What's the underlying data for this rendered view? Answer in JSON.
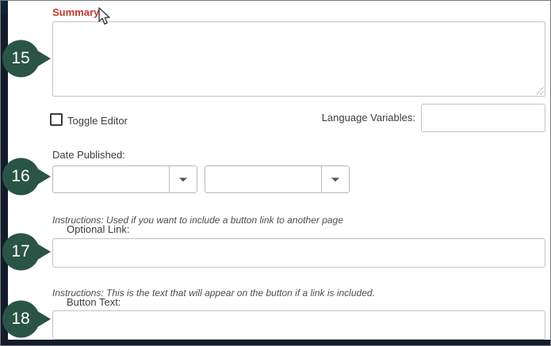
{
  "colors": {
    "callout_green": "#2a5446",
    "frame_dark": "#131c2b",
    "frame_top_teal": "#0e2433",
    "summary_red": "#c13a2c",
    "label_gray": "#3d3d3d",
    "input_border": "#c2c2c2"
  },
  "callouts": [
    {
      "number": "15"
    },
    {
      "number": "16"
    },
    {
      "number": "17"
    },
    {
      "number": "18"
    }
  ],
  "summary": {
    "label": "Summary:",
    "value": ""
  },
  "editor": {
    "toggle_label": "Toggle Editor",
    "checked": false
  },
  "language_variables": {
    "label": "Language Variables:",
    "value": ""
  },
  "date_published": {
    "label": "Date Published:",
    "dropdowns": [
      {
        "value": ""
      },
      {
        "value": ""
      }
    ]
  },
  "optional_link": {
    "instructions": "Instructions: Used if you want to include a button link to another page",
    "label": "Optional Link:",
    "value": ""
  },
  "button_text": {
    "instructions": "Instructions: This is the text that will appear on the button if a link is included.",
    "label": "Button Text:",
    "value": ""
  }
}
